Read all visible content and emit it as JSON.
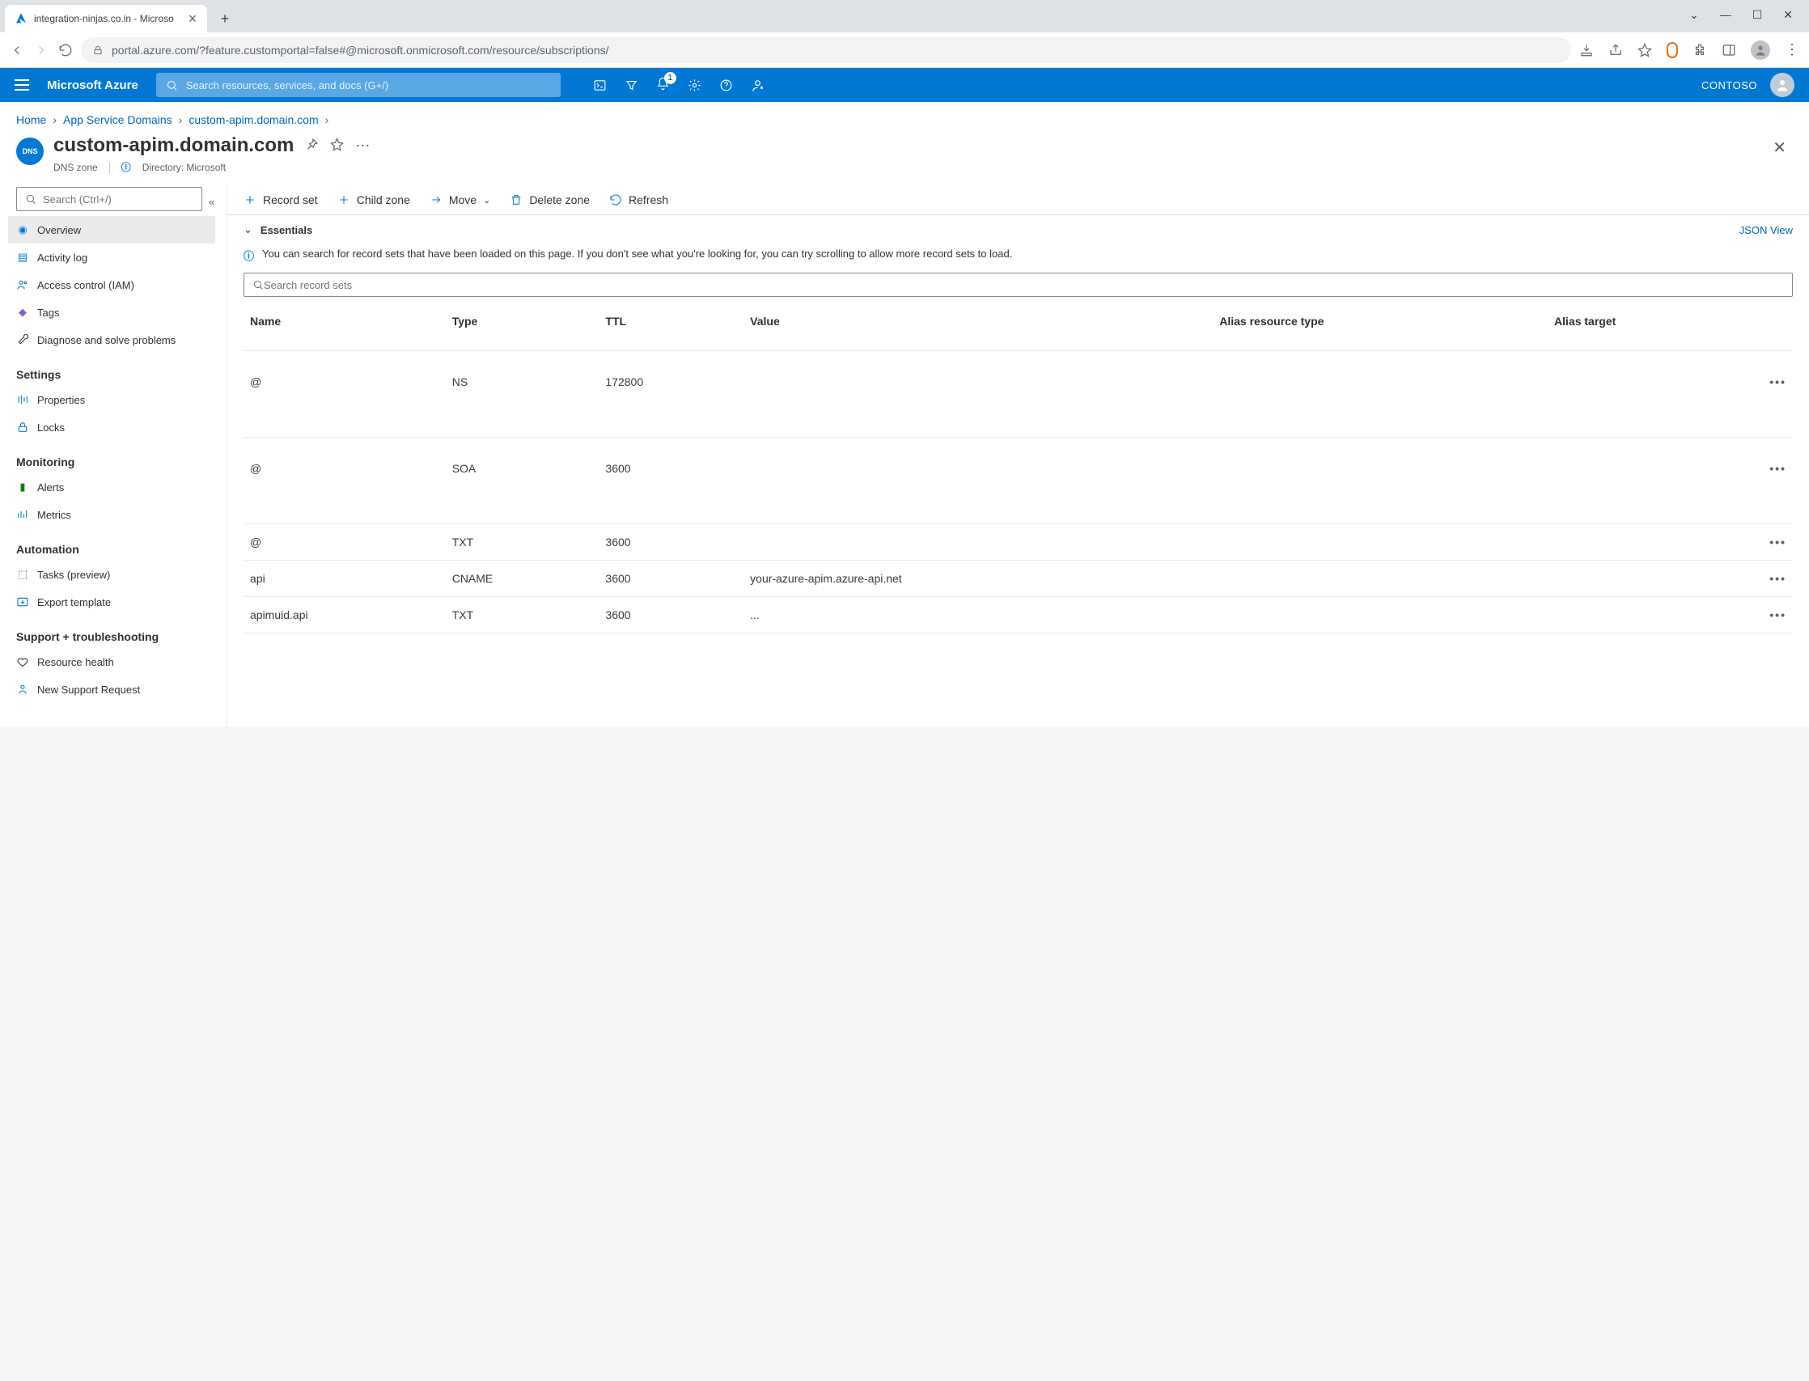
{
  "browser": {
    "tab_title": "integration-ninjas.co.in - Microso",
    "address": "portal.azure.com/?feature.customportal=false#@microsoft.onmicrosoft.com/resource/subscriptions/"
  },
  "header": {
    "brand": "Microsoft Azure",
    "search_placeholder": "Search resources, services, and docs (G+/)",
    "notification_count": "1",
    "tenant": "CONTOSO"
  },
  "breadcrumbs": [
    "Home",
    "App Service Domains",
    "custom-apim.domain.com"
  ],
  "title": {
    "name": "custom-apim.domain.com",
    "subtitle": "DNS zone",
    "directory_label": "Directory: Microsoft"
  },
  "sidebar": {
    "search_placeholder": "Search (Ctrl+/)",
    "top": [
      "Overview",
      "Activity log",
      "Access control (IAM)",
      "Tags",
      "Diagnose and solve problems"
    ],
    "sections": [
      {
        "heading": "Settings",
        "items": [
          "Properties",
          "Locks"
        ]
      },
      {
        "heading": "Monitoring",
        "items": [
          "Alerts",
          "Metrics"
        ]
      },
      {
        "heading": "Automation",
        "items": [
          "Tasks (preview)",
          "Export template"
        ]
      },
      {
        "heading": "Support + troubleshooting",
        "items": [
          "Resource health",
          "New Support Request"
        ]
      }
    ]
  },
  "commands": {
    "record_set": "Record set",
    "child_zone": "Child zone",
    "move": "Move",
    "delete_zone": "Delete zone",
    "refresh": "Refresh"
  },
  "essentials_label": "Essentials",
  "json_view": "JSON View",
  "info_text": "You can search for record sets that have been loaded on this page. If you don't see what you're looking for, you can try scrolling to allow more record sets to load.",
  "record_search_placeholder": "Search record sets",
  "table": {
    "columns": [
      "Name",
      "Type",
      "TTL",
      "Value",
      "Alias resource type",
      "Alias target"
    ],
    "rows": [
      {
        "name": "@",
        "type": "NS",
        "ttl": "172800",
        "value": "",
        "tall": true
      },
      {
        "name": "@",
        "type": "SOA",
        "ttl": "3600",
        "value": "",
        "tall": true
      },
      {
        "name": "@",
        "type": "TXT",
        "ttl": "3600",
        "value": ""
      },
      {
        "name": "api",
        "type": "CNAME",
        "ttl": "3600",
        "value": "your-azure-apim.azure-api.net"
      },
      {
        "name": "apimuid.api",
        "type": "TXT",
        "ttl": "3600",
        "value": "..."
      }
    ]
  }
}
